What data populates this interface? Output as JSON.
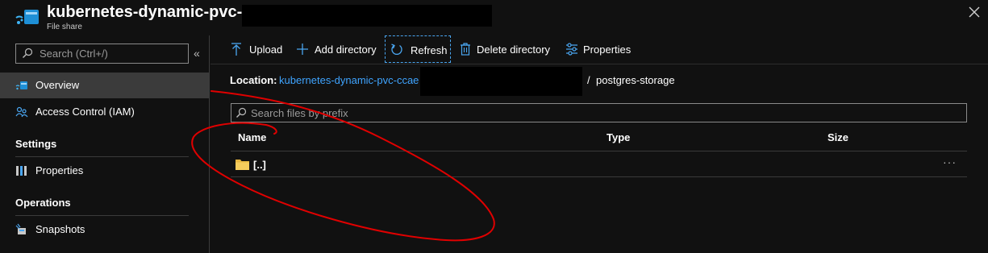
{
  "header": {
    "title": "kubernetes-dynamic-pvc-ccae",
    "subtitle": "File share",
    "logo_icon": "storage-file-share-icon",
    "close_icon": "close-icon"
  },
  "sidebar": {
    "search_placeholder": "Search (Ctrl+/)",
    "collapse_label": "«",
    "items_top": [
      {
        "label": "Overview",
        "icon": "file-share-icon",
        "active": true
      },
      {
        "label": "Access Control (IAM)",
        "icon": "people-icon",
        "active": false
      }
    ],
    "settings_heading": "Settings",
    "settings_items": [
      {
        "label": "Properties",
        "icon": "properties-icon"
      }
    ],
    "operations_heading": "Operations",
    "operations_items": [
      {
        "label": "Snapshots",
        "icon": "snapshots-icon"
      }
    ]
  },
  "toolbar": {
    "upload": "Upload",
    "add_directory": "Add directory",
    "refresh": "Refresh",
    "delete_directory": "Delete directory",
    "properties": "Properties"
  },
  "location": {
    "label": "Location:",
    "share_link": "kubernetes-dynamic-pvc-ccae",
    "separator": "/",
    "path": "postgres-storage"
  },
  "filter": {
    "placeholder": "Search files by prefix"
  },
  "table": {
    "columns": {
      "name": "Name",
      "type": "Type",
      "size": "Size"
    },
    "rows": [
      {
        "name": "[..]",
        "type": "",
        "size": "",
        "more": "···"
      }
    ]
  },
  "colors": {
    "accent": "#3fa4ff",
    "background": "#111111",
    "active_nav": "#3b3b3b",
    "annotation": "#e00000"
  }
}
